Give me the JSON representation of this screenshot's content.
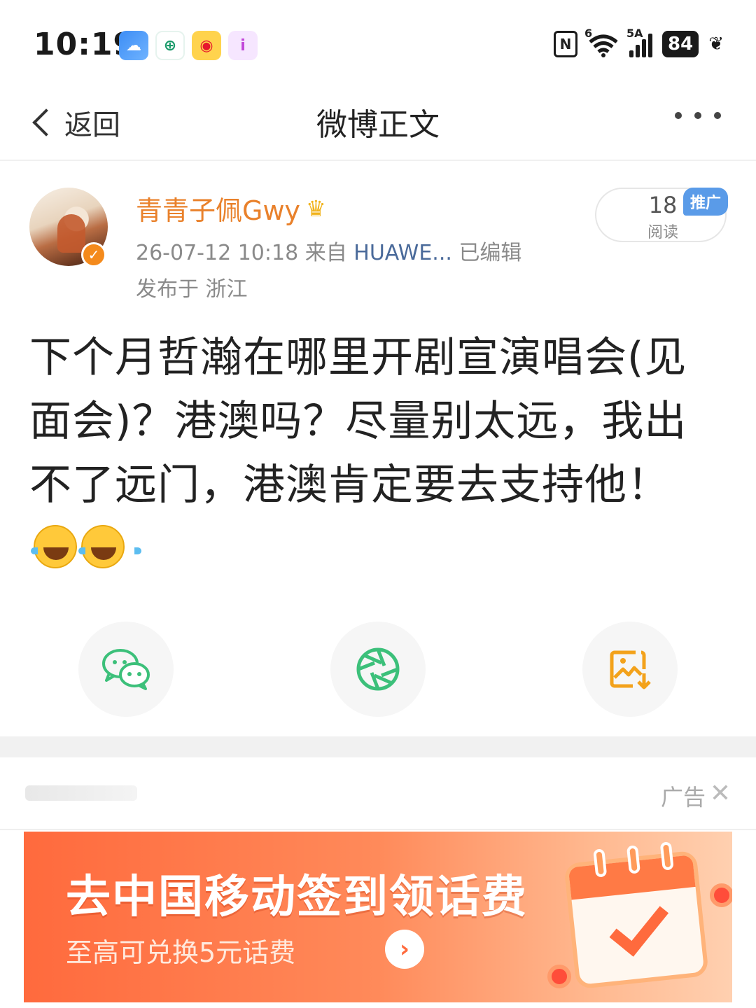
{
  "status_bar": {
    "time": "10:19",
    "icons": [
      "weather-icon",
      "bank-app-icon",
      "weibo-app-icon",
      "purple-app-icon"
    ],
    "nfc_label": "N",
    "wifi_label": "6",
    "signal_label": "5A",
    "battery": "84"
  },
  "nav": {
    "back_label": "返回",
    "title": "微博正文"
  },
  "post": {
    "username": "青青子佩Gwy",
    "date": "26-07-12 10:18",
    "source_prefix": "来自",
    "source_device": "HUAWE...",
    "edited": "已编辑",
    "location": "发布于 浙江",
    "read_count": "18",
    "read_label": "阅读",
    "promo_badge": "推广",
    "body_text": "下个月哲瀚在哪里开剧宣演唱会(见面会)？港澳吗？尽量别太远，我出不了远门，港澳肯定要去支持他！",
    "emojis": [
      "laughing-crying-emoji",
      "laughing-crying-emoji"
    ]
  },
  "share": {
    "buttons": [
      "wechat-icon",
      "moments-icon",
      "save-image-icon"
    ]
  },
  "ad": {
    "tag": "广告",
    "close": "✕",
    "title": "去中国移动签到领话费",
    "subtitle": "至高可兑换5元话费",
    "arrow": "›"
  },
  "colors": {
    "username": "#e9812b",
    "verified": "#f48a1c",
    "promo_badge": "#5a9be8",
    "share_green": "#3cc07a",
    "share_orange": "#f3a21b",
    "ad_orange": "#ff6a3d"
  }
}
